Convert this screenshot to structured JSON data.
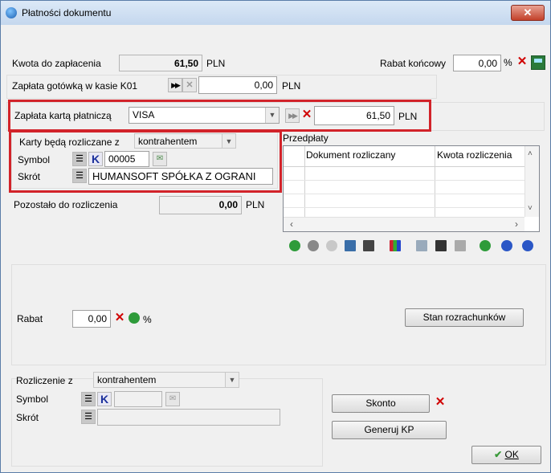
{
  "window": {
    "title": "Płatności dokumentu",
    "close": "✕"
  },
  "kwota": {
    "label": "Kwota do zapłacenia",
    "value": "61,50",
    "currency": "PLN"
  },
  "rabat_koncowy": {
    "label": "Rabat końcowy",
    "value": "0,00",
    "unit": "%"
  },
  "gotowka": {
    "label": "Zapłata gotówką w kasie K01",
    "value": "0,00",
    "currency": "PLN"
  },
  "karta": {
    "label": "Zapłata kartą płatniczą",
    "card": "VISA",
    "value": "61,50",
    "currency": "PLN"
  },
  "karty_rozliczane": {
    "label": "Karty będą rozliczane z",
    "value": "kontrahentem",
    "symbol_label": "Symbol",
    "symbol_k": "K",
    "symbol_value": "00005",
    "skrot_label": "Skrót",
    "skrot_value": "HUMANSOFT SPÓŁKA Z OGRANI"
  },
  "pozostalo": {
    "label": "Pozostało do rozliczenia",
    "value": "0,00",
    "currency": "PLN"
  },
  "przedplaty": {
    "label": "Przedpłaty",
    "columns": [
      "Dokument rozliczany",
      "Kwota rozliczenia"
    ]
  },
  "rabat": {
    "label": "Rabat",
    "value": "0,00",
    "unit": "%"
  },
  "stan_btn": "Stan rozrachunków",
  "rozliczenie": {
    "label": "Rozliczenie z",
    "value": "kontrahentem",
    "symbol_label": "Symbol",
    "symbol_k": "K",
    "skrot_label": "Skrót"
  },
  "skonto_btn": "Skonto",
  "generuj_btn": "Generuj KP",
  "ok_btn": "OK"
}
